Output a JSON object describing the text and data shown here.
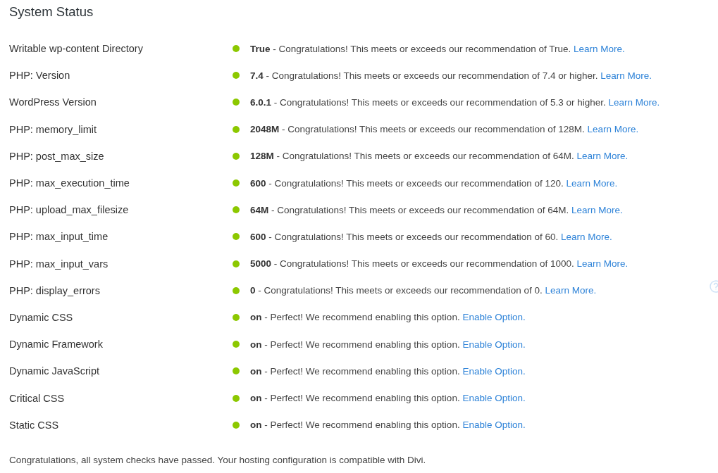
{
  "title": "System Status",
  "rows": [
    {
      "label": "Writable wp-content Directory",
      "text": "**True** - Congratulations! This meets or exceeds our recommendation of True.",
      "link": "Learn More."
    },
    {
      "label": "PHP: Version",
      "text": "**7.4** - Congratulations! This meets or exceeds our recommendation of 7.4 or higher.",
      "link": "Learn More."
    },
    {
      "label": "WordPress Version",
      "text": "**6.0.1** - Congratulations! This meets or exceeds our recommendation of 5.3 or higher.",
      "link": "Learn More."
    },
    {
      "label": "PHP: memory_limit",
      "text": "**2048M** - Congratulations! This meets or exceeds our recommendation of 128M.",
      "link": "Learn More."
    },
    {
      "label": "PHP: post_max_size",
      "text": "**128M** - Congratulations! This meets or exceeds our recommendation of 64M.",
      "link": "Learn More."
    },
    {
      "label": "PHP: max_execution_time",
      "text": "**600** - Congratulations! This meets or exceeds our recommendation of 120.",
      "link": "Learn More."
    },
    {
      "label": "PHP: upload_max_filesize",
      "text": "**64M** - Congratulations! This meets or exceeds our recommendation of 64M.",
      "link": "Learn More."
    },
    {
      "label": "PHP: max_input_time",
      "text": "**600** - Congratulations! This meets or exceeds our recommendation of 60.",
      "link": "Learn More."
    },
    {
      "label": "PHP: max_input_vars",
      "text": "**5000** - Congratulations! This meets or exceeds our recommendation of 1000.",
      "link": "Learn More."
    },
    {
      "label": "PHP: display_errors",
      "text": "**0** - Congratulations! This meets or exceeds our recommendation of 0.",
      "link": "Learn More."
    },
    {
      "label": "Dynamic CSS",
      "text": "**on** - Perfect! We recommend enabling this option.",
      "link": "Enable Option."
    },
    {
      "label": "Dynamic Framework",
      "text": "**on** - Perfect! We recommend enabling this option.",
      "link": "Enable Option."
    },
    {
      "label": "Dynamic JavaScript",
      "text": "**on** - Perfect! We recommend enabling this option.",
      "link": "Enable Option."
    },
    {
      "label": "Critical CSS",
      "text": "**on** - Perfect! We recommend enabling this option.",
      "link": "Enable Option."
    },
    {
      "label": "Static CSS",
      "text": "**on** - Perfect! We recommend enabling this option.",
      "link": "Enable Option."
    }
  ],
  "summary": "Congratulations, all system checks have passed. Your hosting configuration is compatible with Divi."
}
